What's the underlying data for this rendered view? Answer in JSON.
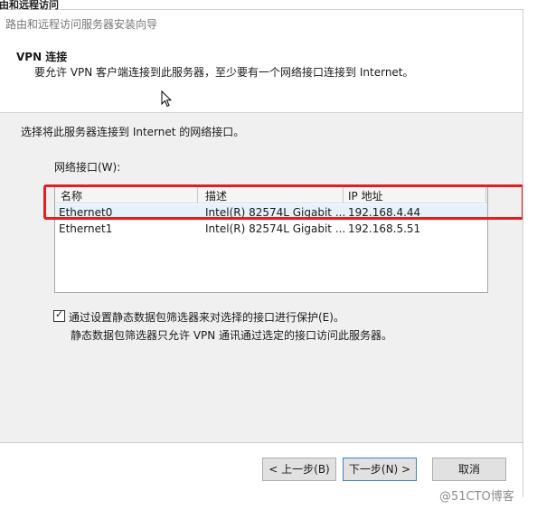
{
  "window": {
    "title": "由和远程访问",
    "wizard_title": "路由和远程访问服务器安装向导"
  },
  "header": {
    "title": "VPN 连接",
    "description": "要允许 VPN 客户端连接到此服务器，至少要有一个网络接口连接到 Internet。"
  },
  "body": {
    "prompt": "选择将此服务器连接到 Internet 的网络接口。",
    "interfaces_label": "网络接口(W):",
    "columns": [
      "名称",
      "描述",
      "IP 地址"
    ],
    "rows": [
      {
        "name": "Ethernet0",
        "description": "Intel(R) 82574L Gigabit ...",
        "ip": "192.168.4.44",
        "selected": true
      },
      {
        "name": "Ethernet1",
        "description": "Intel(R) 82574L Gigabit ...",
        "ip": "192.168.5.51",
        "selected": false
      }
    ],
    "checkbox": {
      "checked": true,
      "label": "通过设置静态数据包筛选器来对选择的接口进行保护(E)。",
      "description": "静态数据包筛选器只允许 VPN 通讯通过选定的接口访问此服务器。"
    }
  },
  "buttons": {
    "back": "< 上一步(B)",
    "next": "下一步(N) >",
    "cancel": "取消"
  },
  "watermark": "@51CTO博客",
  "colors": {
    "highlight": "#e02020",
    "selected_row": "#e5f1fb"
  }
}
